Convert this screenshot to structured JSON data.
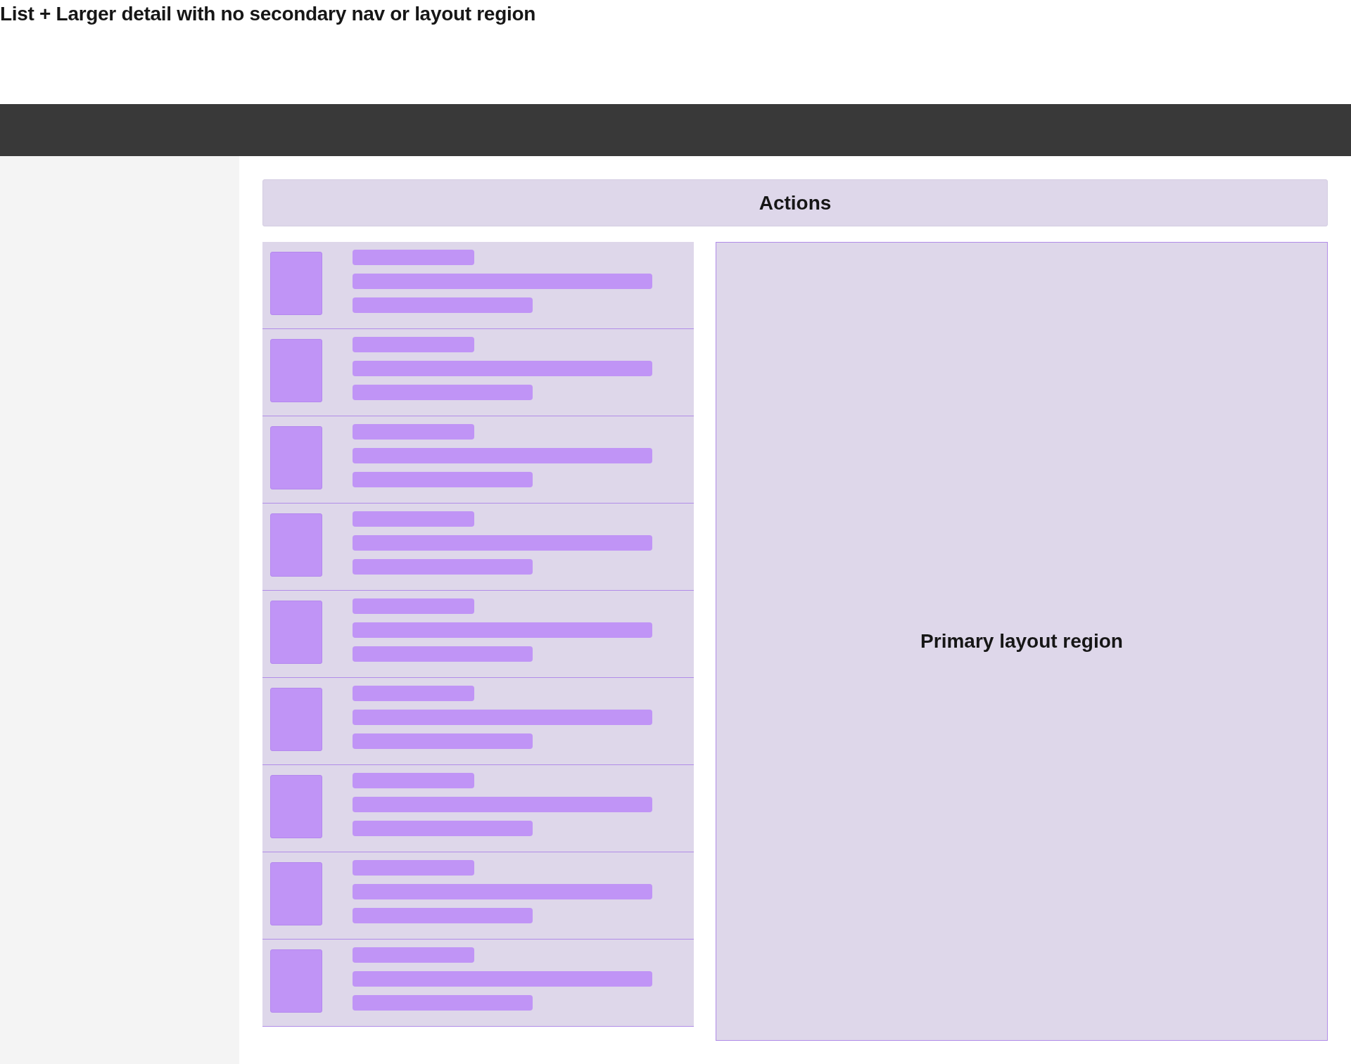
{
  "page_title": "List + Larger detail with no secondary nav or layout region",
  "actions": {
    "label": "Actions"
  },
  "list_items": [
    {
      "kind": "placeholder"
    },
    {
      "kind": "placeholder"
    },
    {
      "kind": "placeholder"
    },
    {
      "kind": "placeholder"
    },
    {
      "kind": "placeholder"
    },
    {
      "kind": "placeholder"
    },
    {
      "kind": "placeholder"
    },
    {
      "kind": "placeholder"
    },
    {
      "kind": "placeholder"
    }
  ],
  "detail": {
    "label": "Primary layout region"
  }
}
